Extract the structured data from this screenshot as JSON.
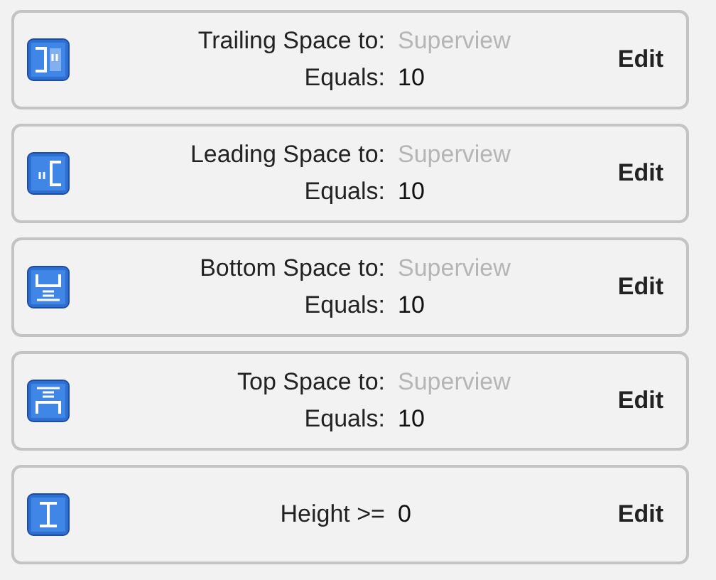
{
  "constraints": [
    {
      "kind": "trailing",
      "lines": [
        {
          "label": "Trailing Space to:",
          "value": "Superview",
          "dimmed": true
        },
        {
          "label": "Equals:",
          "value": "10",
          "dimmed": false
        }
      ],
      "button": "Edit"
    },
    {
      "kind": "leading",
      "lines": [
        {
          "label": "Leading Space to:",
          "value": "Superview",
          "dimmed": true
        },
        {
          "label": "Equals:",
          "value": "10",
          "dimmed": false
        }
      ],
      "button": "Edit"
    },
    {
      "kind": "bottom",
      "lines": [
        {
          "label": "Bottom Space to:",
          "value": "Superview",
          "dimmed": true
        },
        {
          "label": "Equals:",
          "value": "10",
          "dimmed": false
        }
      ],
      "button": "Edit"
    },
    {
      "kind": "top",
      "lines": [
        {
          "label": "Top Space to:",
          "value": "Superview",
          "dimmed": true
        },
        {
          "label": "Equals:",
          "value": "10",
          "dimmed": false
        }
      ],
      "button": "Edit"
    },
    {
      "kind": "height",
      "lines": [
        {
          "label": "Height >=",
          "value": "0",
          "dimmed": false
        }
      ],
      "button": "Edit"
    }
  ]
}
